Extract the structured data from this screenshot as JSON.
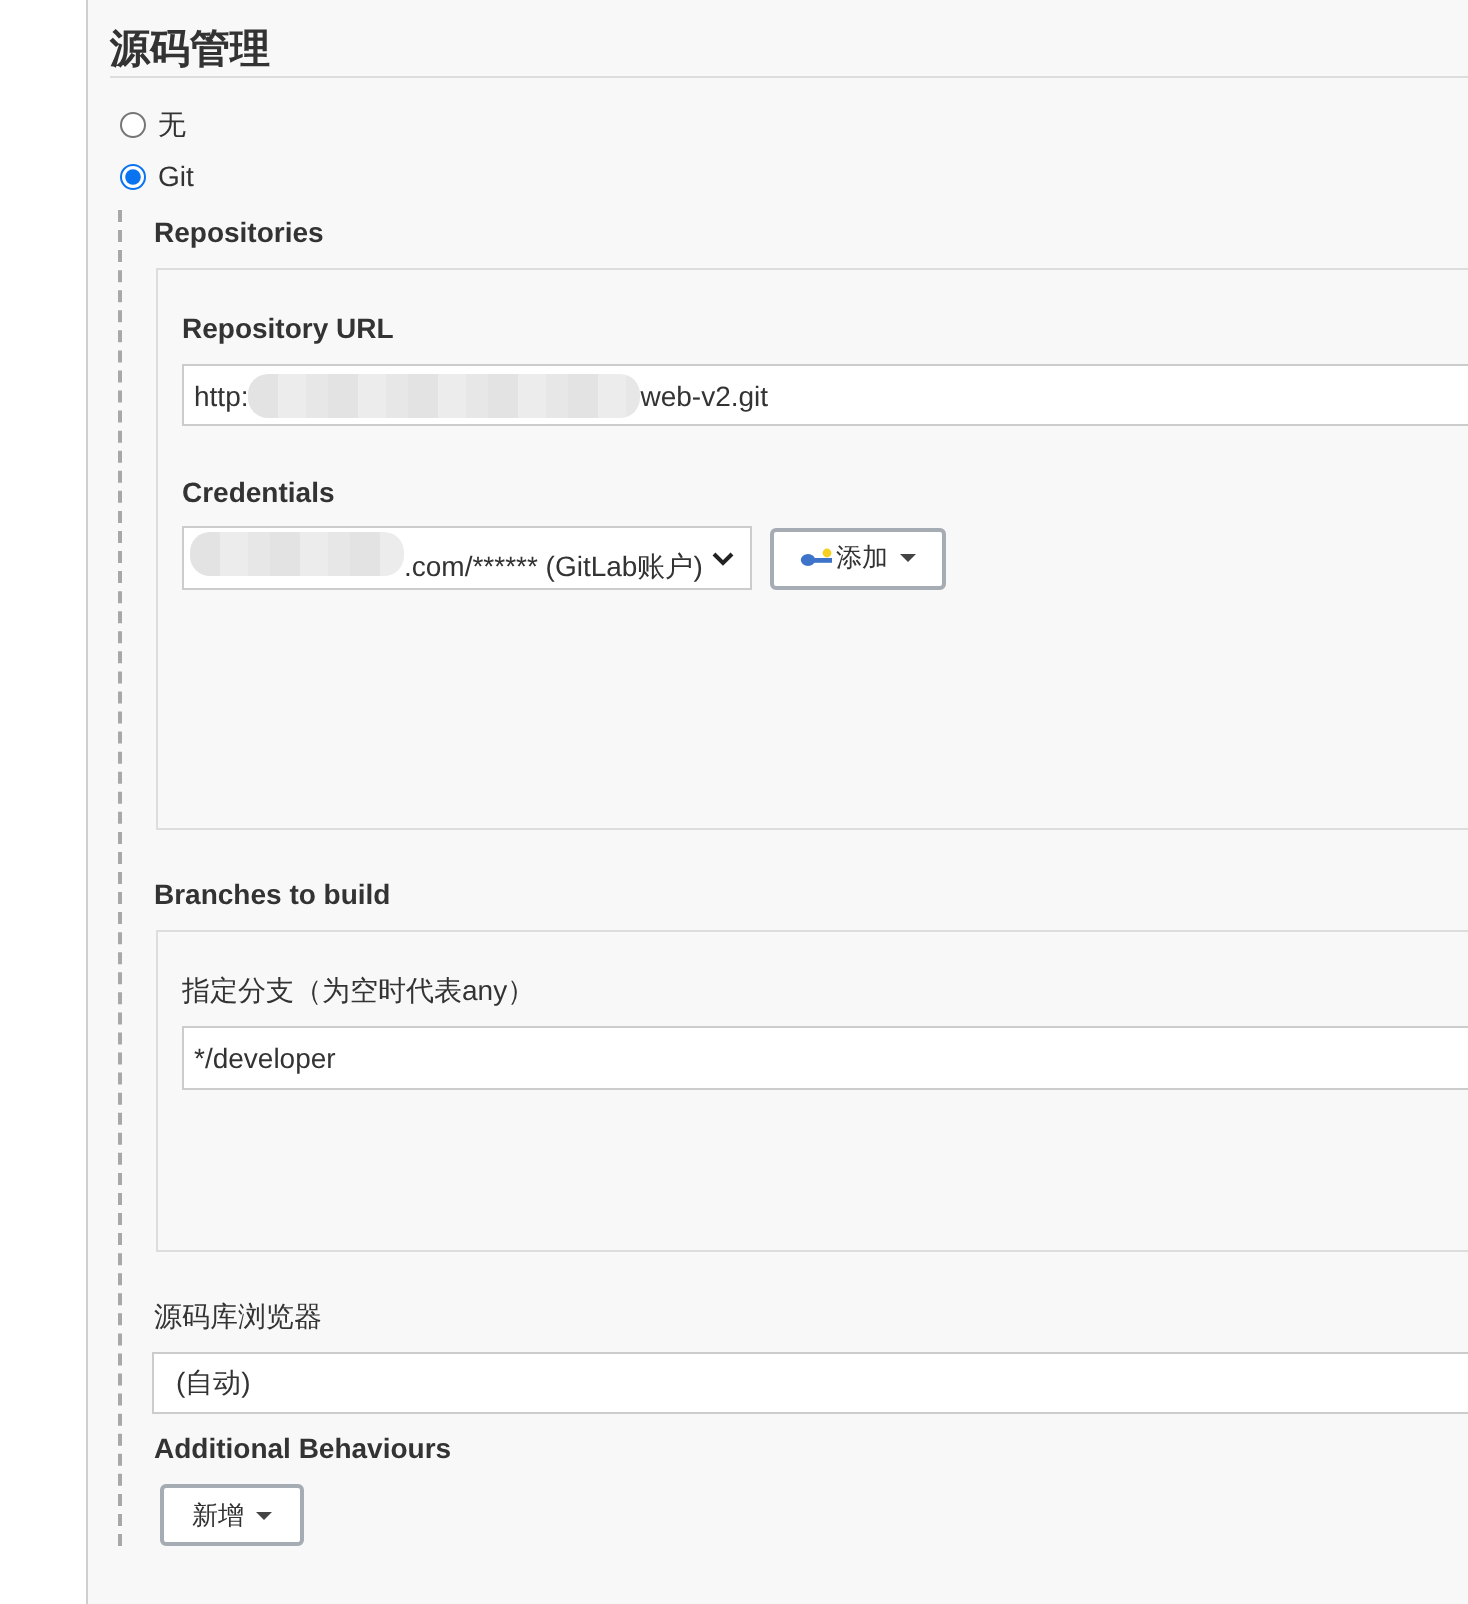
{
  "section": {
    "title": "源码管理"
  },
  "scm_options": [
    {
      "label": "无",
      "selected": false
    },
    {
      "label": "Git",
      "selected": true
    }
  ],
  "repositories": {
    "title": "Repositories",
    "url_field": {
      "label": "Repository URL",
      "value_parts": [
        {
          "kind": "text",
          "text": "http:"
        },
        {
          "kind": "redacted"
        },
        {
          "kind": "text",
          "text": "web-v2.git"
        }
      ]
    },
    "credentials": {
      "label": "Credentials",
      "value_parts": [
        {
          "kind": "redacted"
        },
        {
          "kind": "text",
          "text": ".com/****** (GitLab账户)"
        }
      ],
      "add_button": "添加"
    }
  },
  "branches": {
    "title": "Branches to build",
    "branch_field": {
      "label": "指定分支（为空时代表any）",
      "value": "*/developer"
    }
  },
  "repo_browser": {
    "label": "源码库浏览器",
    "value": "(自动)"
  },
  "additional_behaviours": {
    "title": "Additional Behaviours",
    "add_button": "新增"
  }
}
